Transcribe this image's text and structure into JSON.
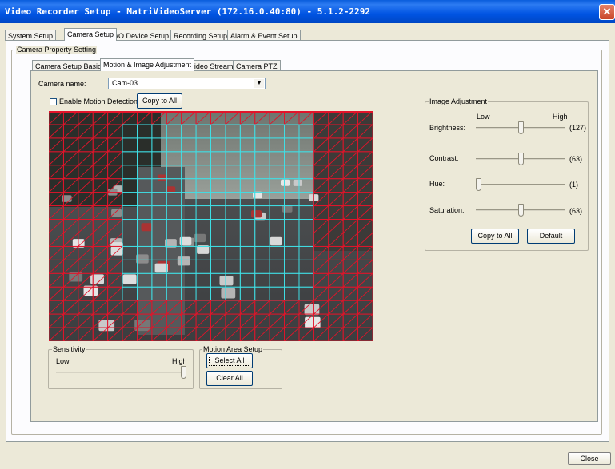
{
  "window": {
    "title": "Video Recorder Setup - MatriVideoServer (172.16.0.40:80) - 5.1.2-2292",
    "close_glyph": "✕"
  },
  "main_tabs": [
    "System Setup",
    "Camera Setup",
    "I/O Device Setup",
    "Recording Setup",
    "Alarm & Event Setup"
  ],
  "main_tab_active": "Camera Setup",
  "property_group": {
    "label": "Camera Property Setting"
  },
  "sub_tabs": [
    "Camera Setup Basic",
    "Motion & Image Adjustment",
    "Video Stream",
    "Camera PTZ"
  ],
  "sub_tab_active": "Motion & Image Adjustment",
  "camera": {
    "label": "Camera name:",
    "value": "Cam-03",
    "arrow": "▼"
  },
  "motion": {
    "enable_label": "Enable Motion Detection",
    "enabled": false,
    "copy_label": "Copy to All",
    "grid_cols": 22,
    "grid_rows": 17,
    "selected_region": {
      "col_start": 5,
      "col_end": 17,
      "row_start": 1,
      "row_end": 13
    },
    "grid_colors": {
      "selected": "#3fe0e6",
      "unselected": "#e2142a"
    }
  },
  "sensitivity": {
    "label": "Sensitivity",
    "low": "Low",
    "high": "High",
    "level": 1.0
  },
  "motion_area": {
    "label": "Motion Area Setup",
    "select_all": "Select All",
    "clear_all": "Clear All"
  },
  "image_adjustment": {
    "label": "Image Adjustment",
    "low": "Low",
    "high": "High",
    "sliders": [
      {
        "name": "Brightness:",
        "value": "(127)",
        "level": 0.5
      },
      {
        "name": "Contrast:",
        "value": "(63)",
        "level": 0.5
      },
      {
        "name": "Hue:",
        "value": "(1)",
        "level": 0.0
      },
      {
        "name": "Saturation:",
        "value": "(63)",
        "level": 0.5
      }
    ],
    "copy_label": "Copy to All",
    "default_label": "Default"
  },
  "footer": {
    "close_label": "Close"
  }
}
